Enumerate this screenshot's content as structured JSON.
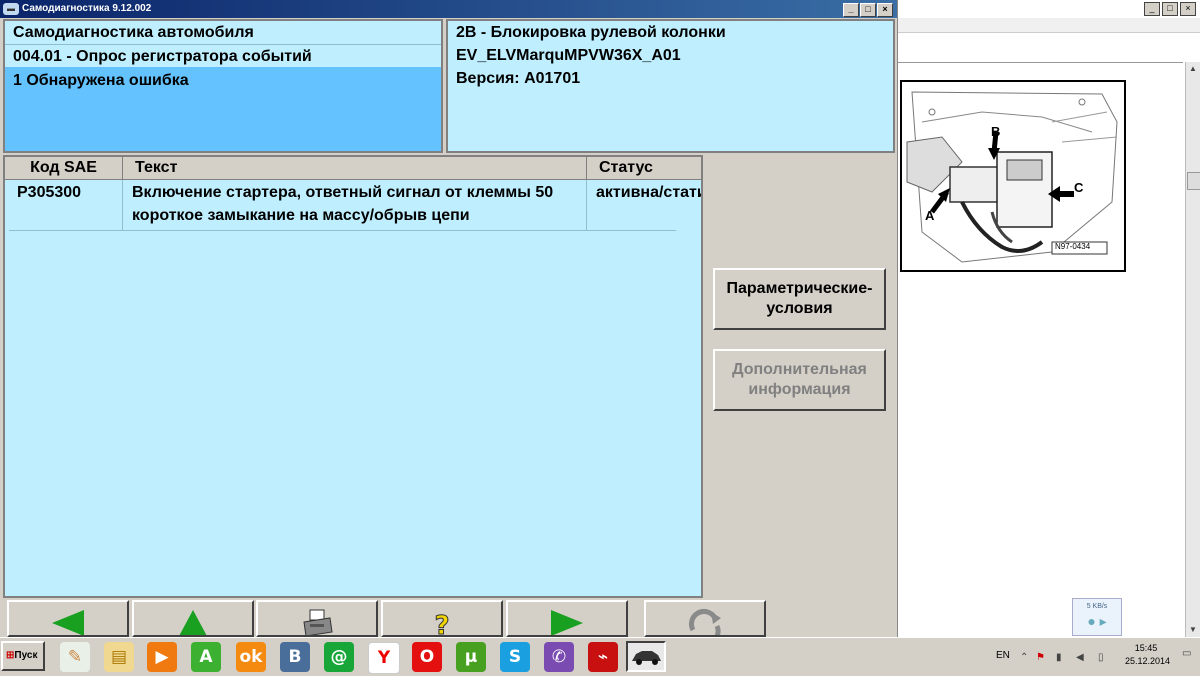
{
  "window": {
    "title": "Самодиагностика 9.12.002",
    "min": "_",
    "max": "□",
    "close": "×"
  },
  "info_left": {
    "line1": "Самодиагностика автомобиля",
    "line2": "004.01 - Опрос регистратора событий",
    "line3": "1 Обнаружена ошибка"
  },
  "info_right": {
    "line1": "2B - Блокировка рулевой колонки",
    "line2": "EV_ELVMarquMPVW36X_A01",
    "line3": "Версия: A01701"
  },
  "table": {
    "headers": [
      "Код SAE",
      "Текст",
      "Статус"
    ],
    "rows": [
      {
        "code": "P305300",
        "text1": "Включение стартера, ответный сигнал от клеммы 50",
        "text2": "короткое замыкание на массу/обрыв цепи",
        "status": "активна/стати"
      }
    ]
  },
  "buttons": {
    "params": "Параметрические-\nусловия",
    "extra": "Дополнительная\nинформация"
  },
  "diagram": {
    "label_a": "A",
    "label_b": "B",
    "label_c": "C",
    "code": "N97-0434"
  },
  "tray_widget": "5 KB/s",
  "taskbar": {
    "start": "Пуск",
    "lang": "EN",
    "time": "15:45",
    "date": "25.12.2014"
  },
  "colors": {
    "panel_bg": "#bfefff",
    "selection": "#64c3ff",
    "arrow_green": "#1aa020"
  },
  "icons": [
    "paint-icon",
    "folder-icon",
    "media-player-icon",
    "a-app-icon",
    "odnoklassniki-icon",
    "vk-icon",
    "mail-icon",
    "yandex-browser-icon",
    "opera-icon",
    "utorrent-icon",
    "skype-icon",
    "viber-icon",
    "pdf-icon"
  ]
}
